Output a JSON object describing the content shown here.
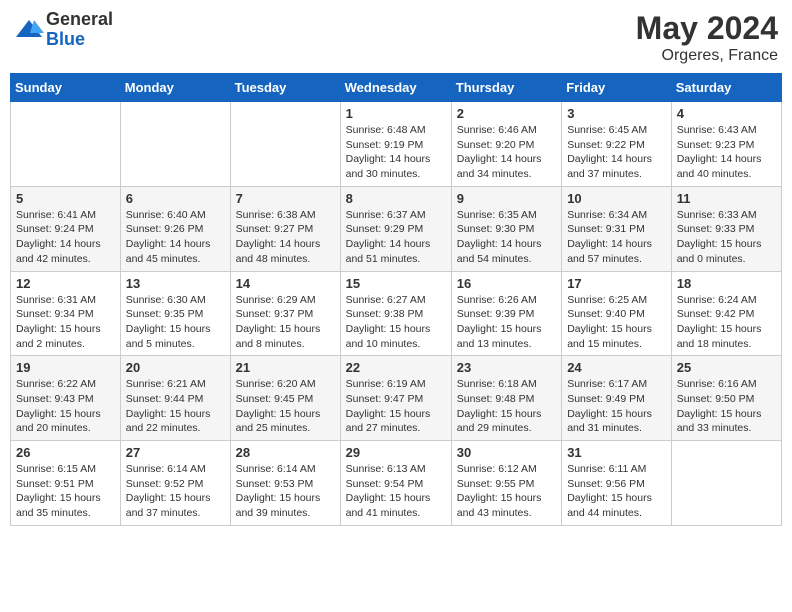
{
  "header": {
    "logo_general": "General",
    "logo_blue": "Blue",
    "month_year": "May 2024",
    "location": "Orgeres, France"
  },
  "weekdays": [
    "Sunday",
    "Monday",
    "Tuesday",
    "Wednesday",
    "Thursday",
    "Friday",
    "Saturday"
  ],
  "weeks": [
    [
      {
        "day": "",
        "info": ""
      },
      {
        "day": "",
        "info": ""
      },
      {
        "day": "",
        "info": ""
      },
      {
        "day": "1",
        "info": "Sunrise: 6:48 AM\nSunset: 9:19 PM\nDaylight: 14 hours\nand 30 minutes."
      },
      {
        "day": "2",
        "info": "Sunrise: 6:46 AM\nSunset: 9:20 PM\nDaylight: 14 hours\nand 34 minutes."
      },
      {
        "day": "3",
        "info": "Sunrise: 6:45 AM\nSunset: 9:22 PM\nDaylight: 14 hours\nand 37 minutes."
      },
      {
        "day": "4",
        "info": "Sunrise: 6:43 AM\nSunset: 9:23 PM\nDaylight: 14 hours\nand 40 minutes."
      }
    ],
    [
      {
        "day": "5",
        "info": "Sunrise: 6:41 AM\nSunset: 9:24 PM\nDaylight: 14 hours\nand 42 minutes."
      },
      {
        "day": "6",
        "info": "Sunrise: 6:40 AM\nSunset: 9:26 PM\nDaylight: 14 hours\nand 45 minutes."
      },
      {
        "day": "7",
        "info": "Sunrise: 6:38 AM\nSunset: 9:27 PM\nDaylight: 14 hours\nand 48 minutes."
      },
      {
        "day": "8",
        "info": "Sunrise: 6:37 AM\nSunset: 9:29 PM\nDaylight: 14 hours\nand 51 minutes."
      },
      {
        "day": "9",
        "info": "Sunrise: 6:35 AM\nSunset: 9:30 PM\nDaylight: 14 hours\nand 54 minutes."
      },
      {
        "day": "10",
        "info": "Sunrise: 6:34 AM\nSunset: 9:31 PM\nDaylight: 14 hours\nand 57 minutes."
      },
      {
        "day": "11",
        "info": "Sunrise: 6:33 AM\nSunset: 9:33 PM\nDaylight: 15 hours\nand 0 minutes."
      }
    ],
    [
      {
        "day": "12",
        "info": "Sunrise: 6:31 AM\nSunset: 9:34 PM\nDaylight: 15 hours\nand 2 minutes."
      },
      {
        "day": "13",
        "info": "Sunrise: 6:30 AM\nSunset: 9:35 PM\nDaylight: 15 hours\nand 5 minutes."
      },
      {
        "day": "14",
        "info": "Sunrise: 6:29 AM\nSunset: 9:37 PM\nDaylight: 15 hours\nand 8 minutes."
      },
      {
        "day": "15",
        "info": "Sunrise: 6:27 AM\nSunset: 9:38 PM\nDaylight: 15 hours\nand 10 minutes."
      },
      {
        "day": "16",
        "info": "Sunrise: 6:26 AM\nSunset: 9:39 PM\nDaylight: 15 hours\nand 13 minutes."
      },
      {
        "day": "17",
        "info": "Sunrise: 6:25 AM\nSunset: 9:40 PM\nDaylight: 15 hours\nand 15 minutes."
      },
      {
        "day": "18",
        "info": "Sunrise: 6:24 AM\nSunset: 9:42 PM\nDaylight: 15 hours\nand 18 minutes."
      }
    ],
    [
      {
        "day": "19",
        "info": "Sunrise: 6:22 AM\nSunset: 9:43 PM\nDaylight: 15 hours\nand 20 minutes."
      },
      {
        "day": "20",
        "info": "Sunrise: 6:21 AM\nSunset: 9:44 PM\nDaylight: 15 hours\nand 22 minutes."
      },
      {
        "day": "21",
        "info": "Sunrise: 6:20 AM\nSunset: 9:45 PM\nDaylight: 15 hours\nand 25 minutes."
      },
      {
        "day": "22",
        "info": "Sunrise: 6:19 AM\nSunset: 9:47 PM\nDaylight: 15 hours\nand 27 minutes."
      },
      {
        "day": "23",
        "info": "Sunrise: 6:18 AM\nSunset: 9:48 PM\nDaylight: 15 hours\nand 29 minutes."
      },
      {
        "day": "24",
        "info": "Sunrise: 6:17 AM\nSunset: 9:49 PM\nDaylight: 15 hours\nand 31 minutes."
      },
      {
        "day": "25",
        "info": "Sunrise: 6:16 AM\nSunset: 9:50 PM\nDaylight: 15 hours\nand 33 minutes."
      }
    ],
    [
      {
        "day": "26",
        "info": "Sunrise: 6:15 AM\nSunset: 9:51 PM\nDaylight: 15 hours\nand 35 minutes."
      },
      {
        "day": "27",
        "info": "Sunrise: 6:14 AM\nSunset: 9:52 PM\nDaylight: 15 hours\nand 37 minutes."
      },
      {
        "day": "28",
        "info": "Sunrise: 6:14 AM\nSunset: 9:53 PM\nDaylight: 15 hours\nand 39 minutes."
      },
      {
        "day": "29",
        "info": "Sunrise: 6:13 AM\nSunset: 9:54 PM\nDaylight: 15 hours\nand 41 minutes."
      },
      {
        "day": "30",
        "info": "Sunrise: 6:12 AM\nSunset: 9:55 PM\nDaylight: 15 hours\nand 43 minutes."
      },
      {
        "day": "31",
        "info": "Sunrise: 6:11 AM\nSunset: 9:56 PM\nDaylight: 15 hours\nand 44 minutes."
      },
      {
        "day": "",
        "info": ""
      }
    ]
  ]
}
